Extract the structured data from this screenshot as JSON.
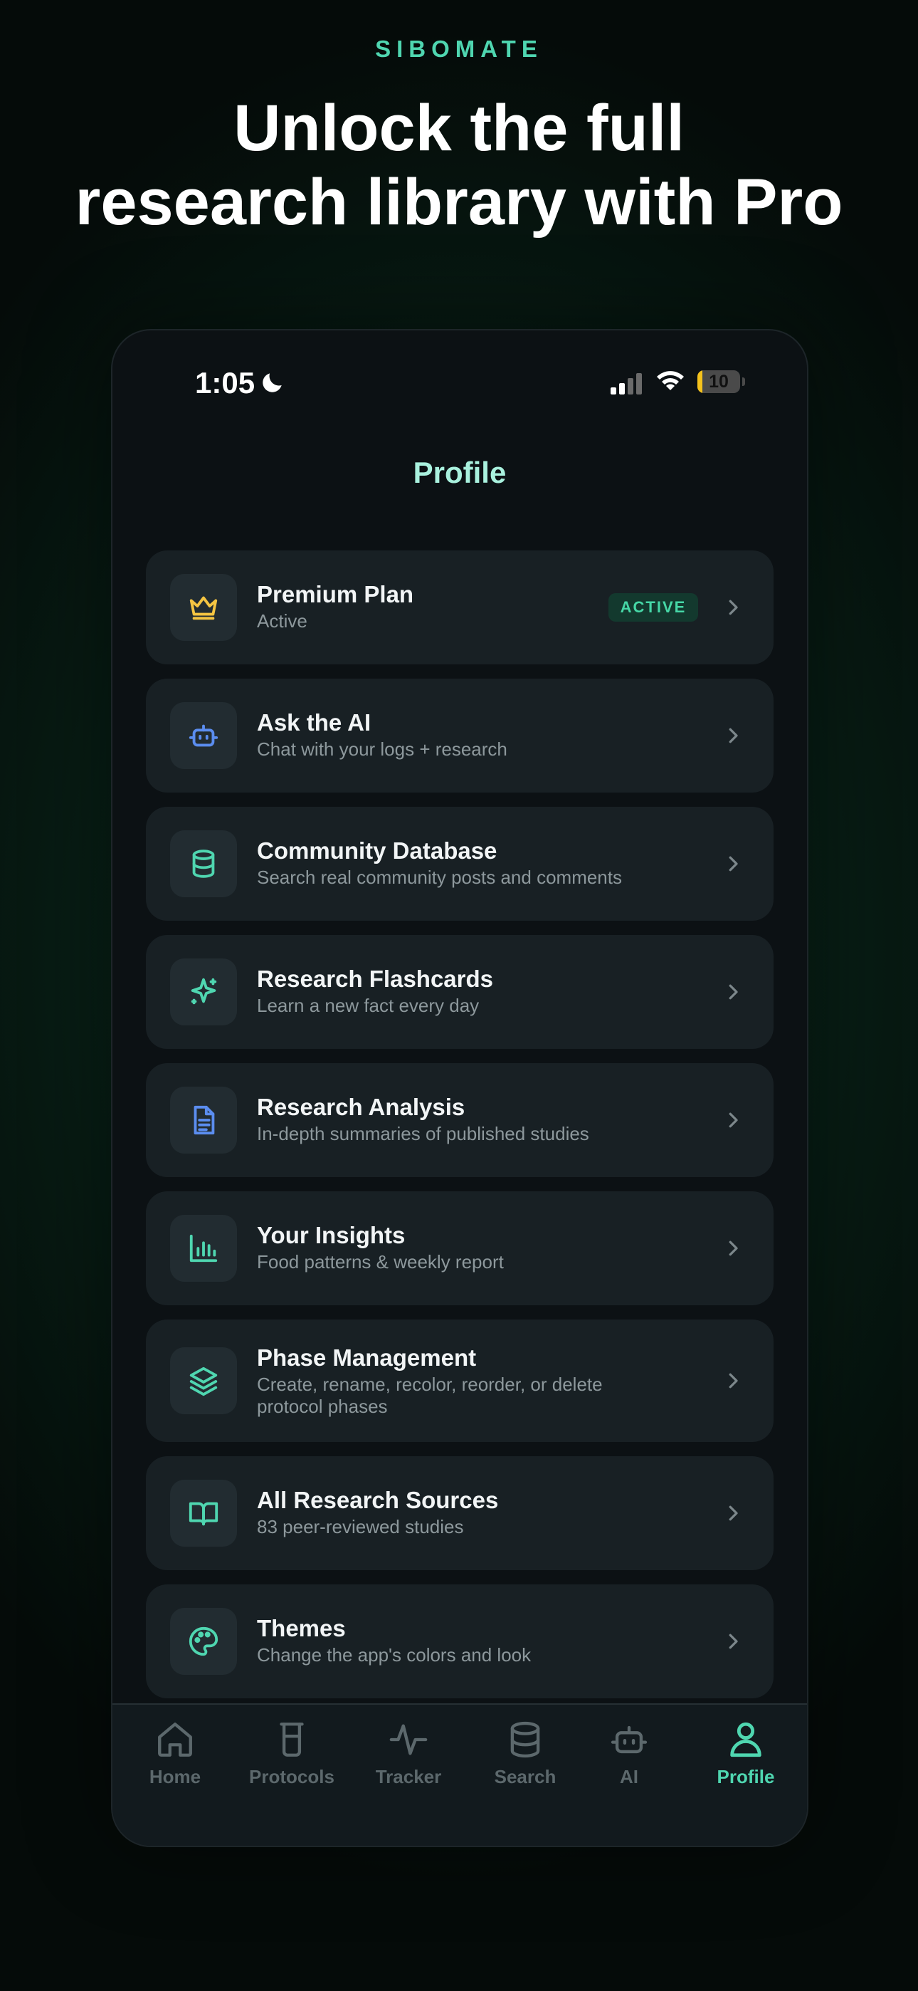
{
  "brand": "SIBOMATE",
  "headline": [
    "Unlock the full",
    "research library with Pro"
  ],
  "status_bar": {
    "time": "1:05",
    "battery": "10"
  },
  "screen_title": "Profile",
  "items": [
    {
      "title": "Premium Plan",
      "subtitle": "Active",
      "badge": "ACTIVE",
      "icon": "crown-icon",
      "color": "#f5c542"
    },
    {
      "title": "Ask the AI",
      "subtitle": "Chat with your logs + research",
      "icon": "robot-icon",
      "color": "#5b8def"
    },
    {
      "title": "Community Database",
      "subtitle": "Search real community posts and comments",
      "icon": "database-icon",
      "color": "#4fd6b0"
    },
    {
      "title": "Research Flashcards",
      "subtitle": "Learn a new fact every day",
      "icon": "sparkle-icon",
      "color": "#4fd6b0"
    },
    {
      "title": "Research Analysis",
      "subtitle": "In-depth summaries of published studies",
      "icon": "document-icon",
      "color": "#5b8def"
    },
    {
      "title": "Your Insights",
      "subtitle": "Food patterns & weekly report",
      "icon": "bar-chart-icon",
      "color": "#4fd6b0"
    },
    {
      "title": "Phase Management",
      "subtitle": "Create, rename, recolor, reorder, or delete protocol phases",
      "icon": "layers-icon",
      "color": "#4fd6b0"
    },
    {
      "title": "All Research Sources",
      "subtitle": "83 peer-reviewed studies",
      "icon": "book-icon",
      "color": "#4fd6b0"
    },
    {
      "title": "Themes",
      "subtitle": "Change the app's colors and look",
      "icon": "palette-icon",
      "color": "#4fd6b0"
    }
  ],
  "tabs": [
    {
      "label": "Home",
      "icon": "home-icon"
    },
    {
      "label": "Protocols",
      "icon": "beaker-icon"
    },
    {
      "label": "Tracker",
      "icon": "pulse-icon"
    },
    {
      "label": "Search",
      "icon": "database-icon"
    },
    {
      "label": "AI",
      "icon": "robot-icon"
    },
    {
      "label": "Profile",
      "icon": "user-icon",
      "active": true
    }
  ],
  "colors": {
    "accent": "#4fd6b0",
    "title": "#a9f1de",
    "card": "#182024",
    "badge_bg": "#13392e"
  }
}
